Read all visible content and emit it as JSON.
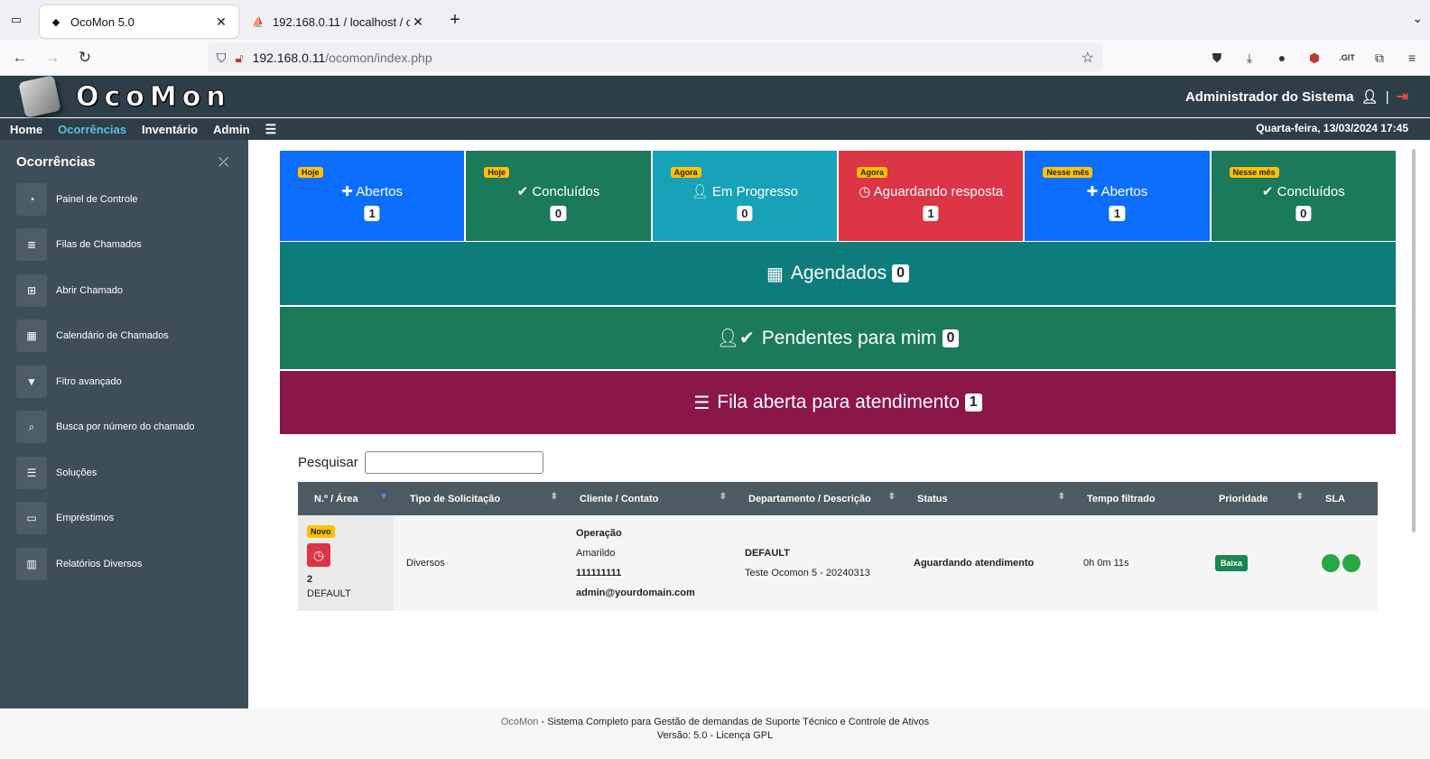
{
  "browser": {
    "tabs": [
      {
        "title": "OcoMon 5.0",
        "active": true
      },
      {
        "title": "192.168.0.11 / localhost / o",
        "active": false
      }
    ],
    "url_host": "192.168.0.11",
    "url_path": "/ocomon/index.php",
    "ext_label": ".GIT"
  },
  "header": {
    "logo_text": "OcoMon",
    "user": "Administrador do Sistema",
    "separator": "|"
  },
  "menu": {
    "items": [
      {
        "label": "Home"
      },
      {
        "label": "Ocorrências"
      },
      {
        "label": "Inventário"
      },
      {
        "label": "Admin"
      }
    ],
    "datetime": "Quarta-feira, 13/03/2024 17:45"
  },
  "sidebar": {
    "title": "Ocorrências",
    "items": [
      {
        "label": "Painel de Controle",
        "icon": "gauge-icon"
      },
      {
        "label": "Filas de Chamados",
        "icon": "list-icon"
      },
      {
        "label": "Abrir Chamado",
        "icon": "plus-square-icon"
      },
      {
        "label": "Calendário de Chamados",
        "icon": "calendar-icon"
      },
      {
        "label": "Fitro avançado",
        "icon": "filter-icon"
      },
      {
        "label": "Busca por número do chamado",
        "icon": "search-icon"
      },
      {
        "label": "Soluções",
        "icon": "database-icon"
      },
      {
        "label": "Empréstimos",
        "icon": "hdd-icon"
      },
      {
        "label": "Relatórios Diversos",
        "icon": "chart-icon"
      }
    ]
  },
  "cards": [
    {
      "badge": "Hoje",
      "label": "Abertos",
      "count": "1",
      "color": "#0d6efd",
      "icon": "✚"
    },
    {
      "badge": "Hoje",
      "label": "Concluídos",
      "count": "0",
      "color": "#1a7a5a",
      "icon": "✔"
    },
    {
      "badge": "Agora",
      "label": "Em Progresso",
      "count": "0",
      "color": "#17a2b8",
      "icon": "👤"
    },
    {
      "badge": "Agora",
      "label": "Aguardando resposta",
      "count": "1",
      "color": "#dc3545",
      "icon": "🕓"
    },
    {
      "badge": "Nesse mês",
      "label": "Abertos",
      "count": "1",
      "color": "#0d6efd",
      "icon": "✚"
    },
    {
      "badge": "Nesse mês",
      "label": "Concluídos",
      "count": "0",
      "color": "#1a7a5a",
      "icon": "✔"
    }
  ],
  "bars": {
    "agendados": {
      "label": "Agendados",
      "count": "0",
      "color": "#0f7c7c"
    },
    "pendentes": {
      "label": "Pendentes para mim",
      "count": "0",
      "color": "#1a7a5a"
    },
    "fila": {
      "label": "Fila aberta para atendimento",
      "count": "1",
      "color": "#8b1648"
    }
  },
  "search": {
    "label": "Pesquisar",
    "value": ""
  },
  "table": {
    "headers": [
      "N.º / Área",
      "Tipo de Solicitação",
      "Cliente / Contato",
      "Departamento / Descrição",
      "Status",
      "Tempo filtrado",
      "Prioridade",
      "SLA"
    ],
    "row": {
      "badge": "Novo",
      "number": "2",
      "area": "DEFAULT",
      "tipo": "Diversos",
      "cliente": "Operação",
      "contato": "Amarildo",
      "telefone": "111111111",
      "email": "admin@yourdomain.com",
      "departamento": "DEFAULT",
      "descricao": "Teste Ocomon 5 - 20240313",
      "status": "Aguardando atendimento",
      "tempo": "0h 0m 11s",
      "prioridade": "Baixa"
    }
  },
  "footer": {
    "brand": "OcoMon",
    "dash": " - ",
    "desc": " Sistema Completo para Gestão de demandas de Suporte Técnico e Controle de Ativos",
    "version": "Versão: 5.0 - Licença GPL"
  }
}
